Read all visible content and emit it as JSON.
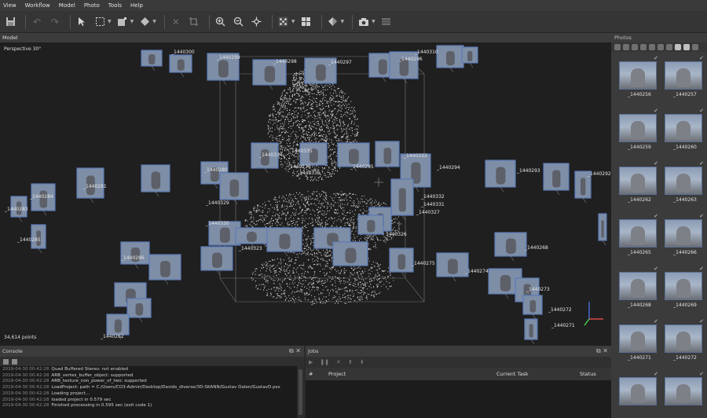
{
  "menu": [
    "View",
    "Workflow",
    "Model",
    "Photo",
    "Tools",
    "Help"
  ],
  "toolbar_icons": [
    "save-icon",
    "undo-icon",
    "redo-icon",
    "navigation-icon",
    "rectangle-selection-icon",
    "resize-region-icon",
    "rotate-region-icon",
    "delete-icon",
    "crop-icon",
    "zoom-in-icon",
    "zoom-out-icon",
    "move-object-icon",
    "show-points-icon",
    "show-cameras-icon",
    "shading-icon",
    "capture-view-icon",
    "grid-icon"
  ],
  "model_panel": {
    "title": "Model",
    "view_mode": "Perspective 30°",
    "points": "34,614 points"
  },
  "camera_labels": [
    {
      "text": "_1440300"
    },
    {
      "text": "_1440299"
    },
    {
      "text": "_1440298"
    },
    {
      "text": "_1440297"
    },
    {
      "text": "_1440296"
    },
    {
      "text": "_1440310"
    },
    {
      "text": "_1440334"
    },
    {
      "text": "_1440335"
    },
    {
      "text": "_1440278"
    },
    {
      "text": "_1440336"
    },
    {
      "text": "_1440295"
    },
    {
      "text": "_1440333"
    },
    {
      "text": "_1440294"
    },
    {
      "text": "_1440293"
    },
    {
      "text": "_1440281"
    },
    {
      "text": "_1440280"
    },
    {
      "text": "_1440329"
    },
    {
      "text": "_1440332"
    },
    {
      "text": "_1440331"
    },
    {
      "text": "_1440327"
    },
    {
      "text": "_1440330"
    },
    {
      "text": "_1440326"
    },
    {
      "text": "_1440284"
    },
    {
      "text": "_1440283"
    },
    {
      "text": "_1440285"
    },
    {
      "text": "_1440323"
    },
    {
      "text": "_1440268"
    },
    {
      "text": "_1440275"
    },
    {
      "text": "_1440274"
    },
    {
      "text": "_1440286"
    },
    {
      "text": "_1440273"
    },
    {
      "text": "_1440272"
    },
    {
      "text": "_1440271"
    },
    {
      "text": "_1440262"
    },
    {
      "text": "_1440292"
    }
  ],
  "photos_panel": {
    "title": "Photos",
    "items": [
      {
        "label": "_1440256"
      },
      {
        "label": "_1440257"
      },
      {
        "label": "_1440259"
      },
      {
        "label": "_1440260"
      },
      {
        "label": "_1440262"
      },
      {
        "label": "_1440263"
      },
      {
        "label": "_1440265"
      },
      {
        "label": "_1440266"
      },
      {
        "label": "_1440268"
      },
      {
        "label": "_1440269"
      },
      {
        "label": "_1440271"
      },
      {
        "label": "_1440272"
      },
      {
        "label": ""
      },
      {
        "label": ""
      }
    ]
  },
  "console": {
    "title": "Console",
    "lines": [
      {
        "ts": "2019-04-30 00:42:28",
        "msg": "Quad Buffered Stereo: not enabled"
      },
      {
        "ts": "2019-04-30 00:42:28",
        "msg": "ARB_vertex_buffer_object: supported"
      },
      {
        "ts": "2019-04-30 00:42:28",
        "msg": "ARB_texture_non_power_of_two: supported"
      },
      {
        "ts": "2019-04-30 00:42:28",
        "msg": "LoadProject: path = C:/Users/CO3-Admin/Desktop/Davids_diverse/3D-SKANN/Gustav Dalen/GustavD.psx"
      },
      {
        "ts": "2019-04-30 00:42:28",
        "msg": "Loading project..."
      },
      {
        "ts": "2019-04-30 00:42:28",
        "msg": "loaded project in 0.579 sec"
      },
      {
        "ts": "2019-04-30 00:42:28",
        "msg": "Finished processing in 0.595 sec (exit code 1)"
      }
    ]
  },
  "jobs": {
    "title": "Jobs",
    "columns": {
      "num": "#",
      "project": "Project",
      "task": "Current Task",
      "status": "Status"
    }
  },
  "colors": {
    "camera_frame": "#5c7bb8",
    "point_cloud": "#b9b9b9",
    "bbox": "#777777"
  }
}
